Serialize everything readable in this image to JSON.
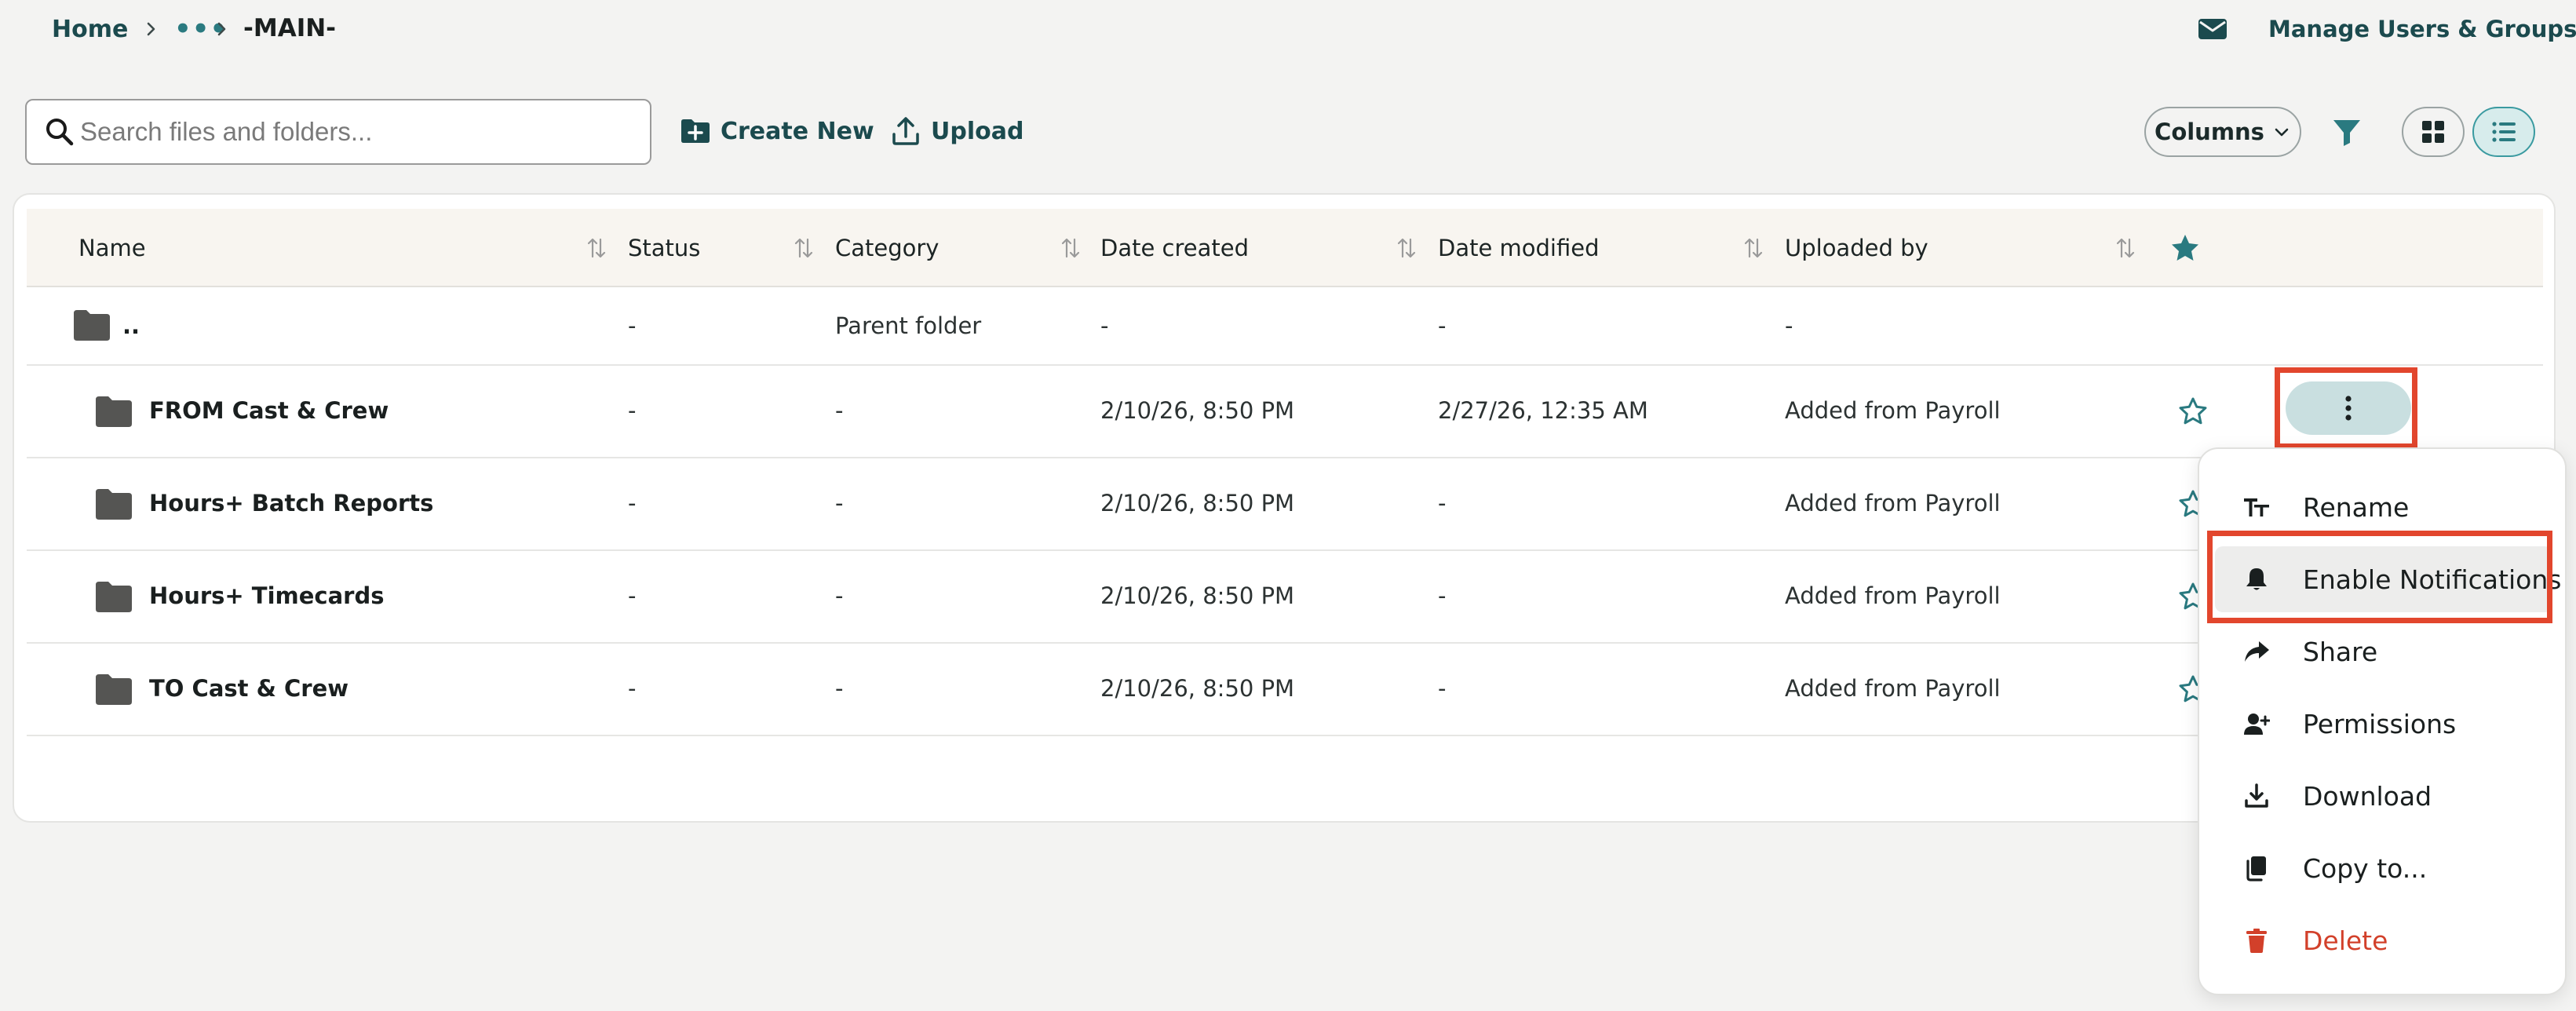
{
  "breadcrumb": {
    "home": "Home",
    "ellipsis": "•••",
    "current": "-MAIN-"
  },
  "header": {
    "manage_label": "Manage Users & Groups",
    "mail_icon": "envelope-icon"
  },
  "toolbar": {
    "search_placeholder": "Search files and folders...",
    "create_label": "Create New",
    "upload_label": "Upload",
    "columns_label": "Columns",
    "active_view": "list"
  },
  "table": {
    "columns": [
      "Name",
      "Status",
      "Category",
      "Date created",
      "Date modified",
      "Uploaded by"
    ],
    "parent_row": {
      "name": "..",
      "status": "-",
      "category": "Parent folder",
      "created": "-",
      "modified": "-",
      "uploaded_by": "-"
    },
    "rows": [
      {
        "name": "FROM Cast & Crew",
        "status": "-",
        "category": "-",
        "created": "2/10/26, 8:50 PM",
        "modified": "2/27/26, 12:35 AM",
        "uploaded_by": "Added from Payroll"
      },
      {
        "name": "Hours+ Batch Reports",
        "status": "-",
        "category": "-",
        "created": "2/10/26, 8:50 PM",
        "modified": "-",
        "uploaded_by": "Added from Payroll"
      },
      {
        "name": "Hours+ Timecards",
        "status": "-",
        "category": "-",
        "created": "2/10/26, 8:50 PM",
        "modified": "-",
        "uploaded_by": "Added from Payroll"
      },
      {
        "name": "TO Cast & Crew",
        "status": "-",
        "category": "-",
        "created": "2/10/26, 8:50 PM",
        "modified": "-",
        "uploaded_by": "Added from Payroll"
      }
    ]
  },
  "menu": {
    "items": [
      {
        "label": "Rename",
        "icon": "text-format-icon"
      },
      {
        "label": "Enable Notifications",
        "icon": "bell-icon"
      },
      {
        "label": "Share",
        "icon": "share-arrow-icon"
      },
      {
        "label": "Permissions",
        "icon": "user-plus-icon"
      },
      {
        "label": "Download",
        "icon": "download-icon"
      },
      {
        "label": "Copy to...",
        "icon": "copy-icon"
      },
      {
        "label": "Delete",
        "icon": "trash-icon"
      }
    ]
  },
  "colors": {
    "accent": "#1b4a4e",
    "teal": "#2a7a80",
    "highlight": "#e2462d",
    "danger": "#d2402a"
  }
}
